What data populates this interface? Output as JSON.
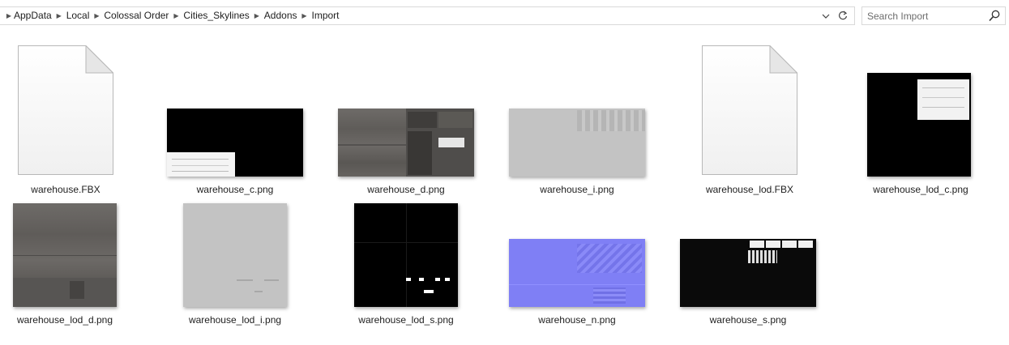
{
  "breadcrumb": {
    "items": [
      "AppData",
      "Local",
      "Colossal Order",
      "Cities_Skylines",
      "Addons",
      "Import"
    ]
  },
  "search": {
    "placeholder": "Search Import"
  },
  "icons": {
    "separator": "chevron-right-icon",
    "dropdown": "chevron-down-icon",
    "refresh": "refresh-icon",
    "search": "search-icon",
    "file": "document-icon"
  },
  "files": [
    {
      "name": "warehouse.FBX",
      "kind": "document"
    },
    {
      "name": "warehouse_c.png",
      "kind": "image"
    },
    {
      "name": "warehouse_d.png",
      "kind": "image"
    },
    {
      "name": "warehouse_i.png",
      "kind": "image"
    },
    {
      "name": "warehouse_lod.FBX",
      "kind": "document"
    },
    {
      "name": "warehouse_lod_c.png",
      "kind": "image"
    },
    {
      "name": "warehouse_lod_d.png",
      "kind": "image"
    },
    {
      "name": "warehouse_lod_i.png",
      "kind": "image"
    },
    {
      "name": "warehouse_lod_s.png",
      "kind": "image"
    },
    {
      "name": "warehouse_n.png",
      "kind": "image"
    },
    {
      "name": "warehouse_s.png",
      "kind": "image"
    }
  ],
  "colors": {
    "normal_map": "#7f7ff5",
    "illumination_gray": "#c3c3c3",
    "border": "#d9d9d9"
  }
}
